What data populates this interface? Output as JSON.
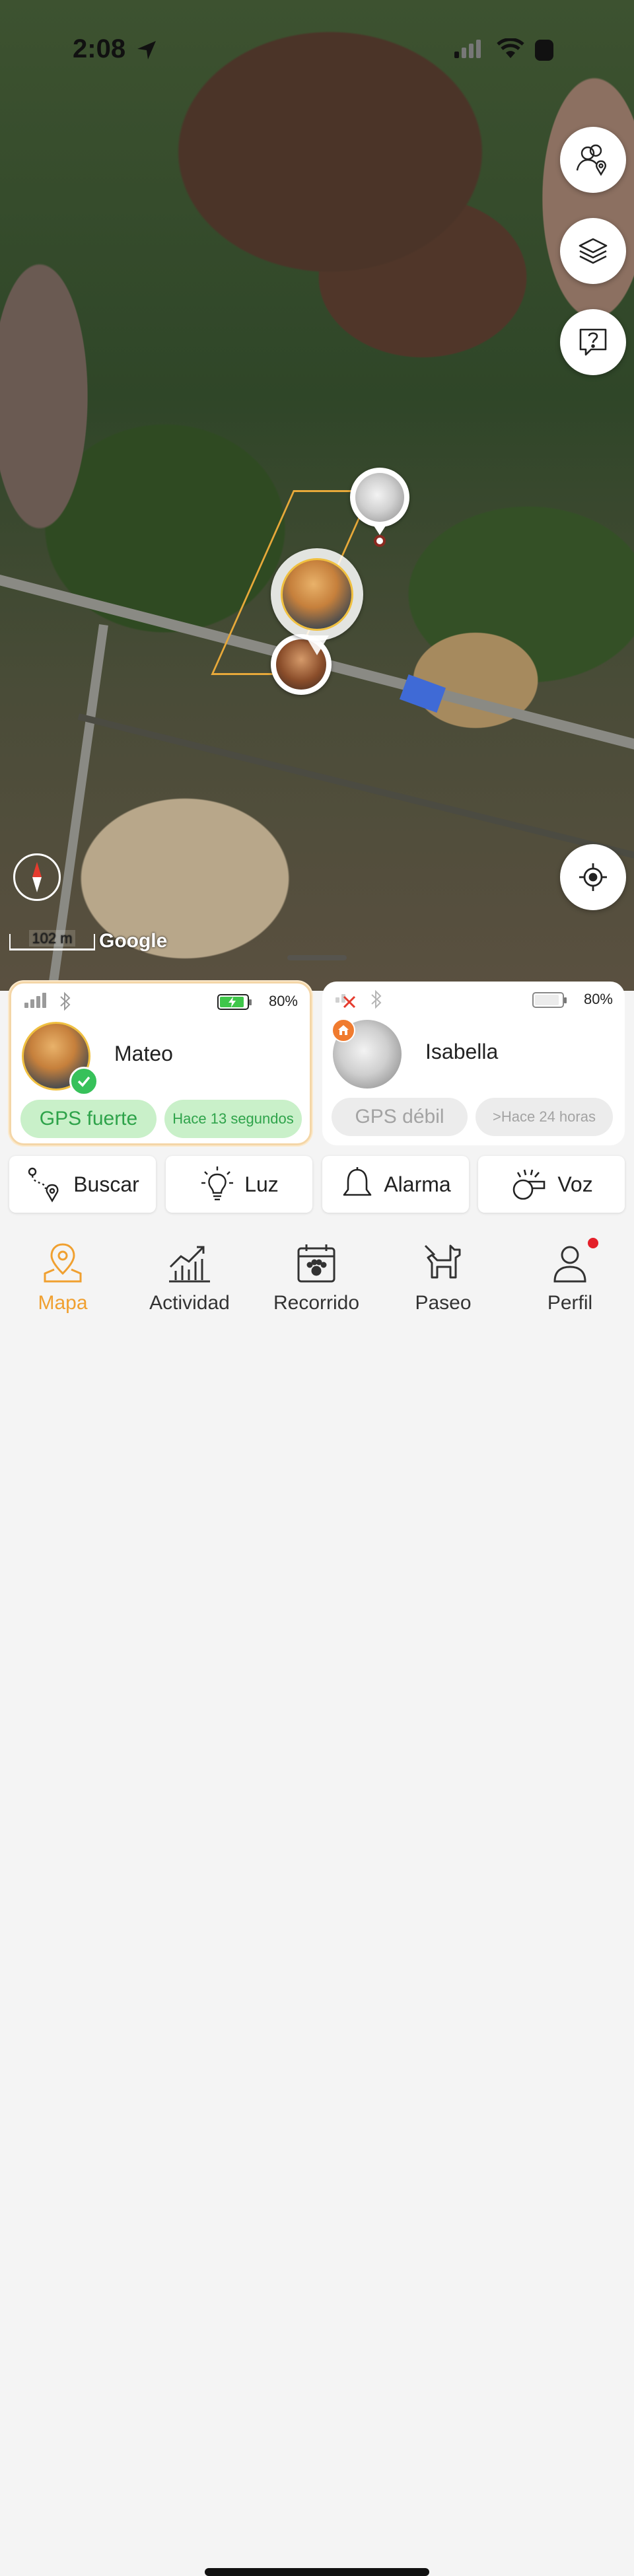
{
  "status_bar": {
    "time": "2:08"
  },
  "map": {
    "scale_label": "102 m",
    "attribution": "Google",
    "fab_buttons": [
      "people-location-icon",
      "layers-icon",
      "help-chat-icon",
      "locate-icon"
    ]
  },
  "pets": [
    {
      "name": "Mateo",
      "battery": "80%",
      "gps": "GPS fuerte",
      "updated": "Hace 13 segundos",
      "charging": true,
      "selected": true,
      "accent": "#37c15a"
    },
    {
      "name": "Isabella",
      "battery": "80%",
      "gps": "GPS débil",
      "updated": ">Hace 24 horas",
      "charging": false,
      "selected": false,
      "accent": "#f07b2f"
    }
  ],
  "actions": [
    {
      "label": "Buscar",
      "icon": "route-search-icon"
    },
    {
      "label": "Luz",
      "icon": "lightbulb-icon"
    },
    {
      "label": "Alarma",
      "icon": "bell-icon"
    },
    {
      "label": "Voz",
      "icon": "whistle-icon"
    }
  ],
  "tabs": [
    {
      "label": "Mapa",
      "icon": "map-pin-icon",
      "active": true
    },
    {
      "label": "Actividad",
      "icon": "activity-chart-icon",
      "active": false
    },
    {
      "label": "Recorrido",
      "icon": "calendar-paw-icon",
      "active": false
    },
    {
      "label": "Paseo",
      "icon": "dog-walk-icon",
      "active": false
    },
    {
      "label": "Perfil",
      "icon": "profile-icon",
      "active": false,
      "badge": true
    }
  ],
  "colors": {
    "accent": "#f0a030",
    "gps_strong_bg": "#c9f0c9",
    "gps_strong_text": "#2ea34a",
    "inactive_chip_bg": "#ececec",
    "inactive_chip_text": "#9b9b9b",
    "badge": "#e4202a"
  }
}
